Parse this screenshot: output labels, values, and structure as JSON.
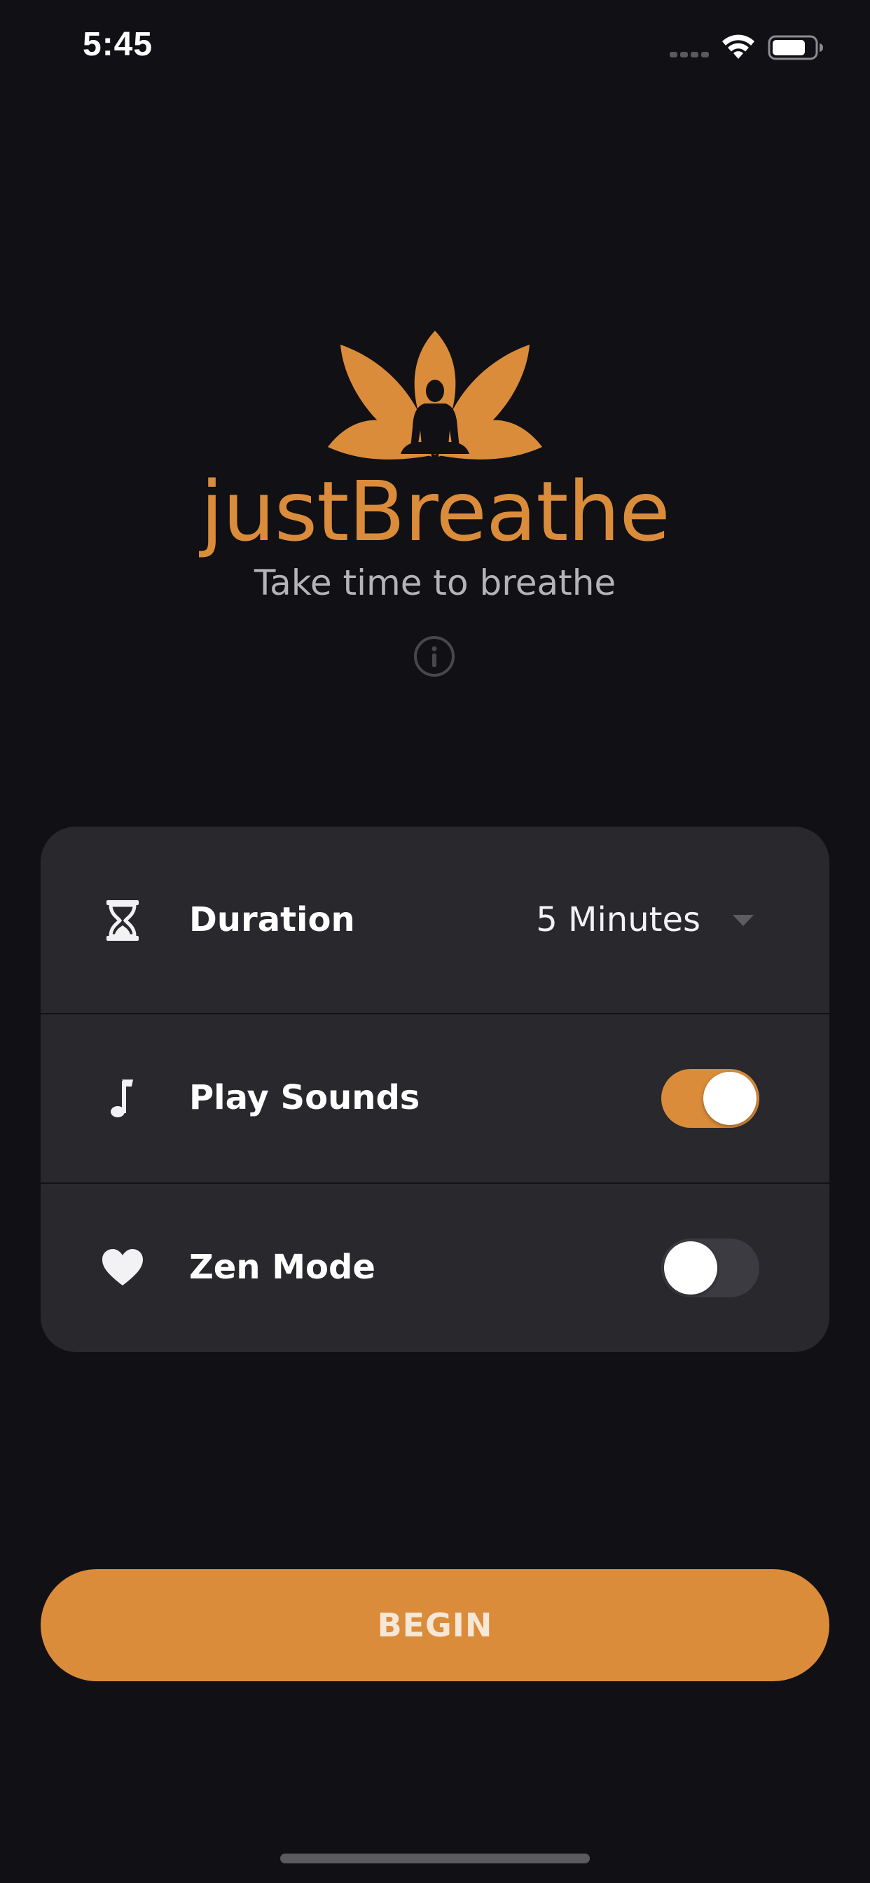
{
  "status_bar": {
    "time": "5:45",
    "signal_icon": "cellular-signal-icon",
    "wifi_icon": "wifi-icon",
    "battery_icon": "battery-icon",
    "battery_level": 0.75
  },
  "branding": {
    "logo_icon": "lotus-meditation-icon",
    "title": "justBreathe",
    "tagline": "Take time to breathe",
    "info_icon": "info-icon"
  },
  "settings": {
    "duration": {
      "icon": "hourglass-icon",
      "label": "Duration",
      "value": "5 Minutes",
      "dropdown_icon": "dropdown-arrow-icon"
    },
    "play_sounds": {
      "icon": "music-note-icon",
      "label": "Play Sounds",
      "enabled": true
    },
    "zen_mode": {
      "icon": "heart-icon",
      "label": "Zen Mode",
      "enabled": false
    }
  },
  "actions": {
    "begin_label": "BEGIN"
  },
  "colors": {
    "background": "#111014",
    "card": "#29282d",
    "accent": "#db8c3a",
    "toggle_off": "#3c3b41",
    "text_primary": "#ffffff",
    "text_secondary": "#b4b3b8"
  }
}
